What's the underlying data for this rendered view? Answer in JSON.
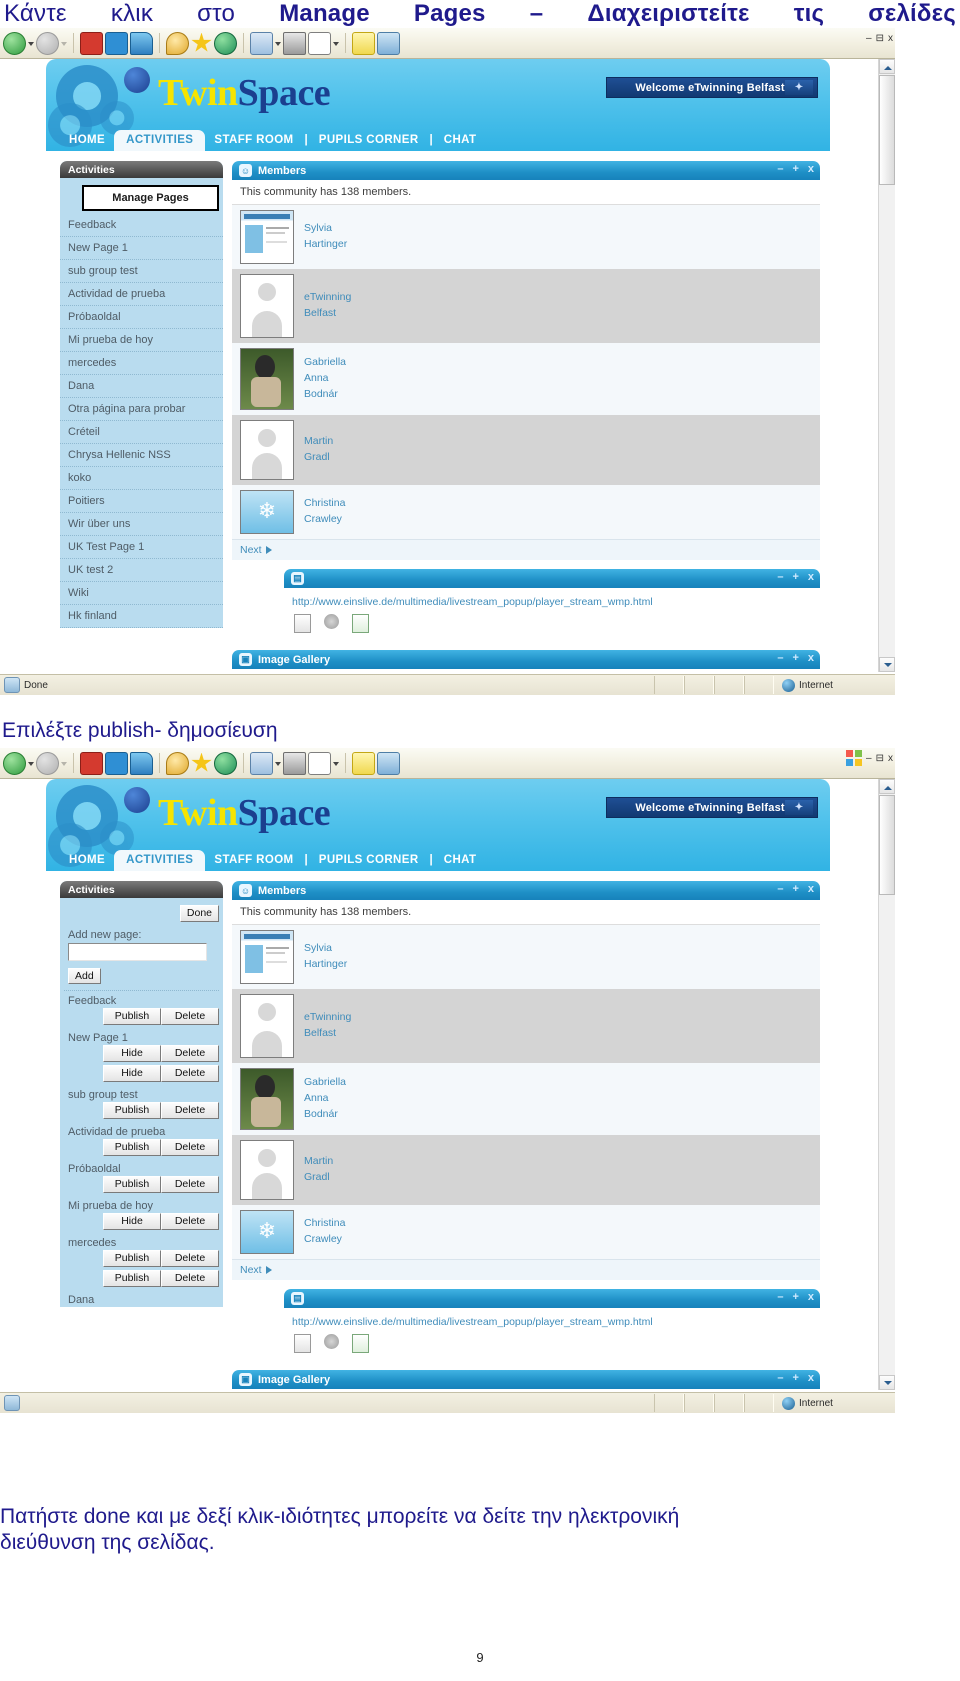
{
  "captions": {
    "top_plain_1": "Κάντε",
    "top_plain_2": "κλικ",
    "top_plain_3": "στο",
    "top_bold_1": "Manage",
    "top_bold_2": "Pages",
    "top_bold_3": "–",
    "top_bold_4": "Διαχειριστείτε",
    "top_bold_5": "τις",
    "top_bold_6": "σελίδες",
    "middle": "Επιλέξτε publish- δημοσίευση",
    "bottom_line1": "Πατήστε done και με δεξί κλικ-ιδιότητες μπορείτε να δείτε την ηλεκτρονική",
    "bottom_line2": "διεύθυνση της σελίδας."
  },
  "page_number": "9",
  "browser": {
    "status_text": "Done",
    "zone_label": "Internet",
    "toolbar_icons": [
      "back-arrow-icon",
      "back-dropdown-icon",
      "forward-arrow-icon",
      "forward-dropdown-icon",
      "stop-icon",
      "refresh-icon",
      "home-icon",
      "search-icon",
      "favorites-star-icon",
      "history-icon",
      "mail-icon",
      "mail-dropdown-icon",
      "print-icon",
      "edit-word-icon",
      "edit-dropdown-icon",
      "notes-icon",
      "messenger-icon"
    ],
    "window_controls": [
      "minimize",
      "restore",
      "close"
    ]
  },
  "site": {
    "logo_part1": "Twin",
    "logo_part2": "Space",
    "welcome_badge": "Welcome eTwinning Belfast!",
    "nav": [
      {
        "label": "HOME",
        "active": false
      },
      {
        "label": "ACTIVITIES",
        "active": true
      },
      {
        "label": "STAFF ROOM",
        "active": false
      },
      {
        "label": "PUPILS CORNER",
        "active": false
      },
      {
        "label": "CHAT",
        "active": false
      }
    ],
    "nav_separator": "|"
  },
  "screenshot1": {
    "sidebar": {
      "title": "Activities",
      "manage_button": "Manage Pages",
      "pages": [
        "Feedback",
        "New Page 1",
        "sub group test",
        "Actividad de prueba",
        "Próbaoldal",
        "Mi prueba de hoy",
        "mercedes",
        "Dana",
        "Otra página para probar",
        "Créteil",
        "Chrysa Hellenic NSS",
        "koko",
        "Poitiers",
        "Wir über uns",
        "UK Test Page 1",
        "UK test 2",
        "Wiki",
        "Hk finland"
      ]
    }
  },
  "screenshot2": {
    "sidebar": {
      "title": "Activities",
      "done_button": "Done",
      "add_label": "Add new page:",
      "add_input_value": "",
      "add_button": "Add",
      "pages": [
        {
          "name": "Feedback",
          "buttons": [
            [
              "Publish",
              "Delete"
            ]
          ]
        },
        {
          "name": "New Page 1",
          "buttons": [
            [
              "Hide",
              "Delete"
            ],
            [
              "Hide",
              "Delete"
            ]
          ]
        },
        {
          "name": "sub group test",
          "buttons": [
            [
              "Publish",
              "Delete"
            ]
          ]
        },
        {
          "name": "Actividad de prueba",
          "buttons": [
            [
              "Publish",
              "Delete"
            ]
          ]
        },
        {
          "name": "Próbaoldal",
          "buttons": [
            [
              "Publish",
              "Delete"
            ]
          ]
        },
        {
          "name": "Mi prueba de hoy",
          "buttons": [
            [
              "Hide",
              "Delete"
            ]
          ]
        },
        {
          "name": "mercedes",
          "buttons": [
            [
              "Publish",
              "Delete"
            ],
            [
              "Publish",
              "Delete"
            ]
          ]
        },
        {
          "name": "Dana",
          "buttons": []
        }
      ]
    }
  },
  "members_panel": {
    "title": "Members",
    "note": "This community has 138 members.",
    "next_label": "Next",
    "members": [
      {
        "first": "Sylvia",
        "last": "Hartinger",
        "avatar": "screenshot-thumb"
      },
      {
        "first": "eTwinning",
        "last": "Belfast",
        "avatar": "placeholder-silhouette"
      },
      {
        "first": "Gabriella",
        "middle": "Anna",
        "last": "Bodnár",
        "avatar": "photo-person"
      },
      {
        "first": "Martin",
        "last": "Gradl",
        "avatar": "placeholder-silhouette"
      },
      {
        "first": "Christina",
        "last": "Crawley",
        "avatar": "photo-snowflake"
      }
    ]
  },
  "link_panel": {
    "url": "http://www.einslive.de/multimedia/livestream_popup/player_stream_wmp.html",
    "icons": [
      "edit-icon",
      "settings-gear-icon",
      "add-page-icon"
    ]
  },
  "gallery_panel": {
    "title": "Image Gallery"
  },
  "panel_controls": {
    "minimize": "–",
    "maximize": "+",
    "close": "x"
  },
  "colors": {
    "heading_blue": "#1f1a8c",
    "panel_blue": "#1e8fc6",
    "sidebar_blue": "#b9dcef",
    "logo_yellow": "#f6e400",
    "logo_navy": "#1b3f8f"
  }
}
